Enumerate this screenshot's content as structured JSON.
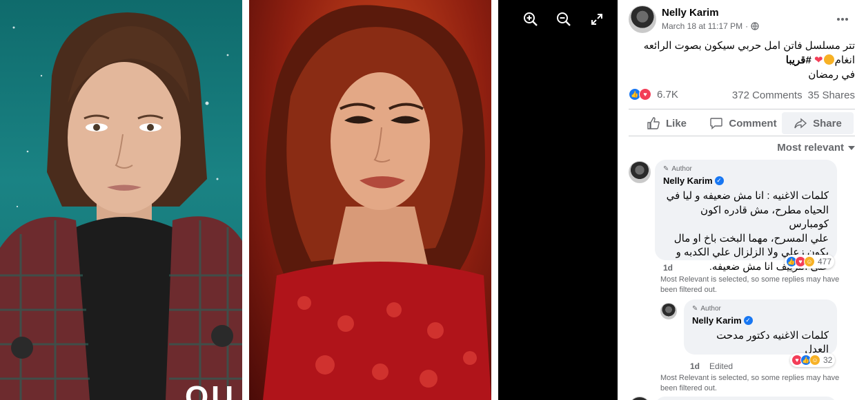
{
  "viewer": {
    "zoom_in_icon": "zoom-in-icon",
    "zoom_out_icon": "zoom-out-icon",
    "fullscreen_icon": "fullscreen-icon",
    "photo_caption_fragment": "OU"
  },
  "post": {
    "author": "Nelly Karim",
    "timestamp": "March 18 at 11:17 PM",
    "separator": "·",
    "privacy_icon": "globe-icon",
    "more_icon": "more-icon",
    "text_line1": "تتر مسلسل فاتن امل حربي سيكون بصوت الرائعه",
    "text_line2_prefix": "انغام",
    "text_line2_hashtag": "#قريبا",
    "text_line3": "في رمضان",
    "reaction_count": "6.7K",
    "comments_count": "372 Comments",
    "shares_count": "35 Shares"
  },
  "actions": {
    "like": "Like",
    "comment": "Comment",
    "share": "Share"
  },
  "sort": {
    "label": "Most relevant"
  },
  "comments": [
    {
      "author_tag": "Author",
      "author": "Nelly Karim",
      "lines": [
        "كلمات الاغنيه : انا مش ضعيفه و ليا في",
        "الحياه مطرح، مش قادره اكون كومبارس",
        "علي المسرح، مهما البخت باخ او مال",
        "يكون زعلي ولا الزلزال علي الكدبه و",
        "على التزييف انا مش ضعيفه."
      ],
      "reactions": "477",
      "time": "1d",
      "filter_note_line1": "Most Relevant is selected, so some replies may have",
      "filter_note_line2": "been filtered out."
    },
    {
      "author_tag": "Author",
      "author": "Nelly Karim",
      "text": "كلمات الاغنيه دكتور مدحت العدل",
      "reactions": "32",
      "time": "1d",
      "edited": "Edited",
      "filter_note_line1": "Most Relevant is selected, so some replies may have",
      "filter_note_line2": "been filtered out."
    }
  ],
  "colors": {
    "accent": "#1877f2",
    "love": "#f33e58",
    "muted": "#65676b"
  }
}
